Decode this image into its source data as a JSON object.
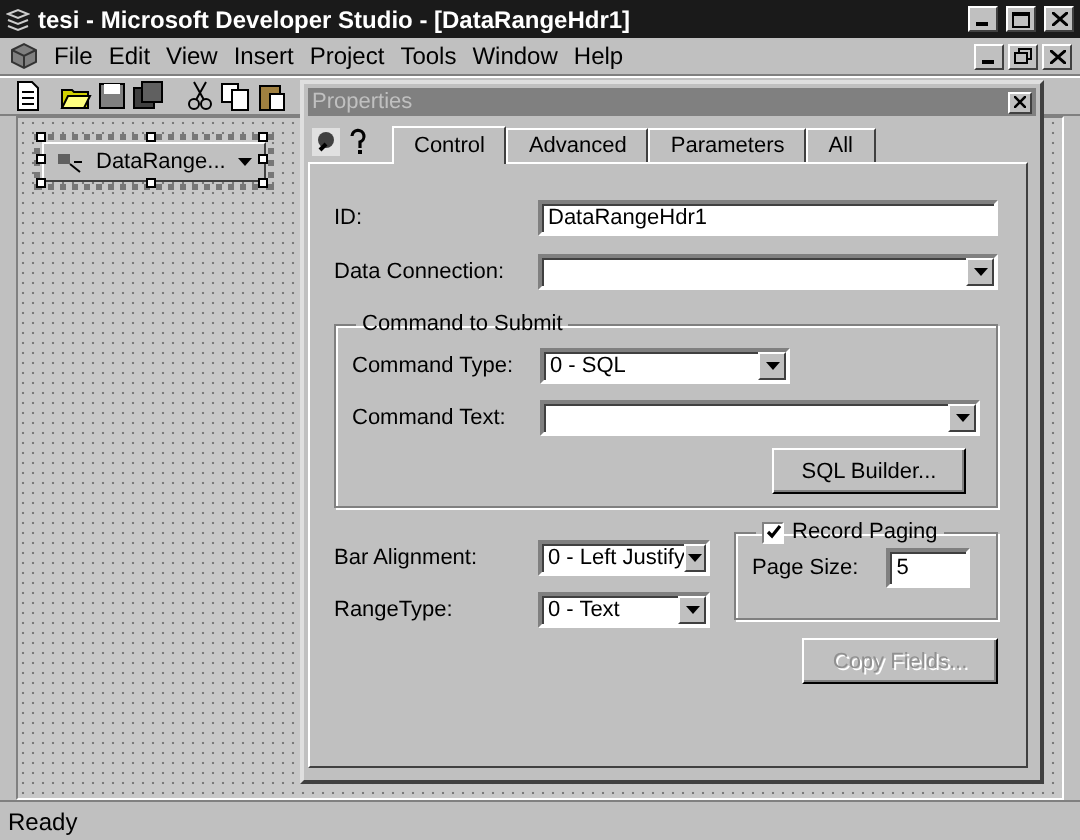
{
  "window": {
    "title": "tesi - Microsoft Developer Studio - [DataRangeHdr1]"
  },
  "menu": [
    "File",
    "Edit",
    "View",
    "Insert",
    "Project",
    "Tools",
    "Window",
    "Help"
  ],
  "canvas": {
    "control_label": "DataRange..."
  },
  "properties": {
    "title": "Properties",
    "tabs": [
      {
        "label": "Control",
        "selected": true
      },
      {
        "label": "Advanced",
        "selected": false
      },
      {
        "label": "Parameters",
        "selected": false
      },
      {
        "label": "All",
        "selected": false
      }
    ],
    "id": {
      "label": "ID:",
      "value": "DataRangeHdr1"
    },
    "data_connection": {
      "label": "Data Connection:"
    },
    "command_group": {
      "title": "Command to Submit",
      "command_type": {
        "label": "Command Type:",
        "value": "0 - SQL"
      },
      "command_text": {
        "label": "Command Text:"
      },
      "sql_builder": {
        "label": "SQL Builder..."
      }
    },
    "bar_alignment": {
      "label": "Bar Alignment:",
      "value": "0 - Left Justify"
    },
    "range_type": {
      "label": "RangeType:",
      "value": "0 - Text"
    },
    "record_paging": {
      "label": "Record Paging",
      "checked": true,
      "page_size": {
        "label": "Page Size:",
        "value": "5"
      }
    },
    "copy_fields": {
      "label": "Copy Fields...",
      "disabled": true
    }
  },
  "status_bar": {
    "text": "Ready"
  }
}
